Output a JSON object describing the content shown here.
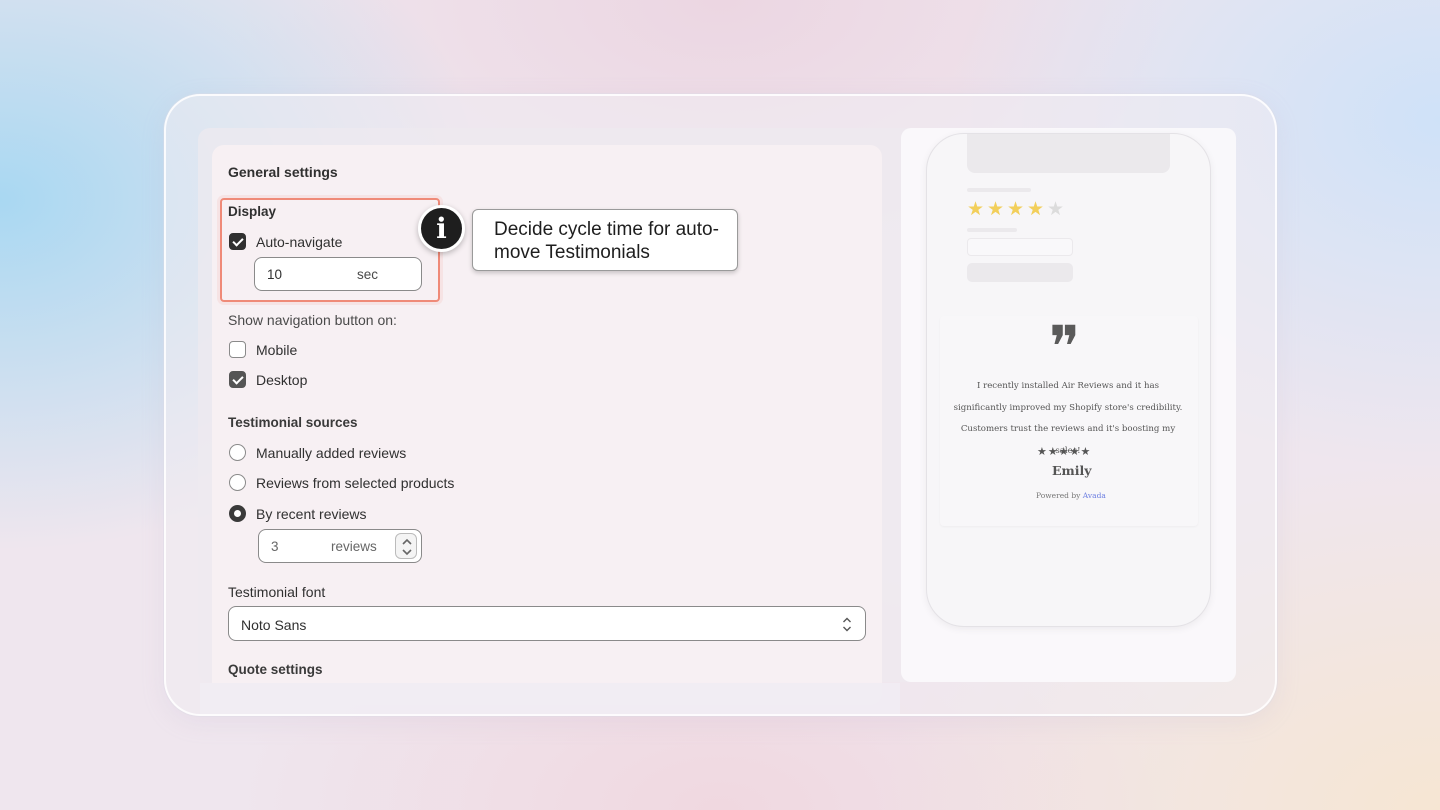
{
  "general_settings": {
    "title": "General settings",
    "display": {
      "title": "Display",
      "auto_navigate": {
        "label": "Auto-navigate",
        "checked": true
      },
      "cycle_time": {
        "value": "10",
        "suffix": "sec"
      }
    },
    "nav_button": {
      "label": "Show navigation button on:",
      "options": [
        {
          "label": "Mobile",
          "checked": false
        },
        {
          "label": "Desktop",
          "checked": true
        }
      ]
    },
    "testimonial_sources": {
      "title": "Testimonial sources",
      "options": [
        {
          "label": "Manually added reviews",
          "selected": false
        },
        {
          "label": "Reviews from selected products",
          "selected": false
        },
        {
          "label": "By recent reviews",
          "selected": true
        }
      ],
      "recent_count": {
        "value": "3",
        "suffix": "reviews"
      }
    },
    "font": {
      "label": "Testimonial font",
      "value": "Noto Sans"
    },
    "quote_settings": {
      "title": "Quote settings"
    }
  },
  "tooltip": {
    "icon": "info-icon",
    "glyph": "i",
    "text": "Decide cycle time for auto-move Testimonials"
  },
  "preview": {
    "rating": {
      "filled": 4,
      "total": 5
    },
    "quote_glyph": "❞",
    "review_text": "I recently installed Air Reviews and it has significantly improved my Shopify store's credibility. Customers trust the reviews and it's boosting my sales!",
    "review_stars": "★★★★★",
    "reviewer": "Emily",
    "powered_by_prefix": "Powered by",
    "powered_by_brand": "Avada"
  },
  "colors": {
    "highlight": "#ef8a78",
    "star_filled": "#f2cf5b",
    "star_empty": "#dcdcdc",
    "brand_link": "#6c7ee1"
  }
}
